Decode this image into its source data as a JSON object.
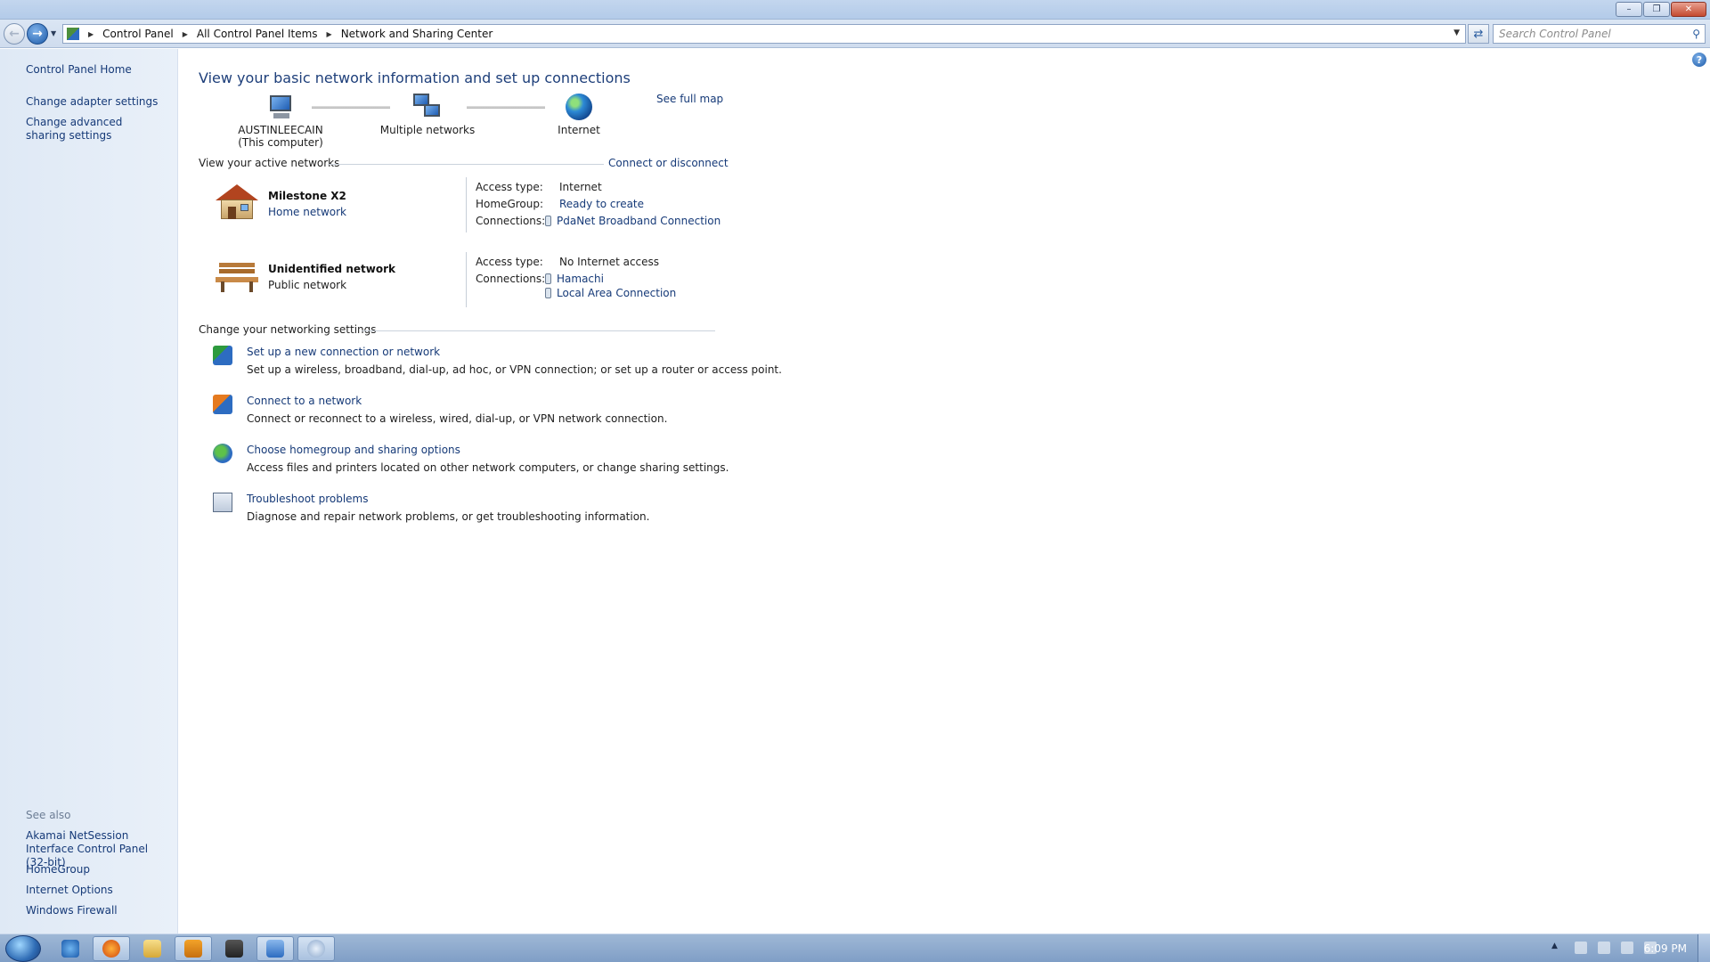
{
  "window": {
    "minimize": "–",
    "restore": "❐",
    "close": "✕"
  },
  "address": {
    "crumbs": [
      "Control Panel",
      "All Control Panel Items",
      "Network and Sharing Center"
    ],
    "search_placeholder": "Search Control Panel"
  },
  "left_pane": {
    "home": "Control Panel Home",
    "links": [
      "Change adapter settings",
      "Change advanced sharing settings"
    ],
    "see_also_title": "See also",
    "see_also": [
      "Akamai NetSession Interface Control Panel (32-bit)",
      "HomeGroup",
      "Internet Options",
      "Windows Firewall"
    ]
  },
  "main": {
    "title": "View your basic network information and set up connections",
    "see_full_map": "See full map",
    "map": {
      "computer_name": "AUSTINLEECAIN",
      "computer_sub": "(This computer)",
      "middle": "Multiple networks",
      "internet": "Internet"
    },
    "active_heading": "View your active networks",
    "connect_disconnect": "Connect or disconnect",
    "networks": [
      {
        "name": "Milestone X2",
        "type": "Home network",
        "labels": [
          "Access type:",
          "HomeGroup:",
          "Connections:"
        ],
        "access": "Internet",
        "homegroup": "Ready to create",
        "connections": [
          "PdaNet Broadband Connection"
        ]
      },
      {
        "name": "Unidentified network",
        "type": "Public network",
        "labels": [
          "Access type:",
          "Connections:"
        ],
        "access": "No Internet access",
        "connections": [
          "Hamachi",
          "Local Area Connection"
        ]
      }
    ],
    "settings_heading": "Change your networking settings",
    "tasks": [
      {
        "link": "Set up a new connection or network",
        "desc": "Set up a wireless, broadband, dial-up, ad hoc, or VPN connection; or set up a router or access point."
      },
      {
        "link": "Connect to a network",
        "desc": "Connect or reconnect to a wireless, wired, dial-up, or VPN network connection."
      },
      {
        "link": "Choose homegroup and sharing options",
        "desc": "Access files and printers located on other network computers, or change sharing settings."
      },
      {
        "link": "Troubleshoot problems",
        "desc": "Diagnose and repair network problems, or get troubleshooting information."
      }
    ]
  },
  "taskbar": {
    "clock": "6:09 PM",
    "apps": [
      "internet-explorer",
      "firefox",
      "windows-explorer",
      "media-player",
      "security",
      "network-center",
      "search"
    ]
  }
}
